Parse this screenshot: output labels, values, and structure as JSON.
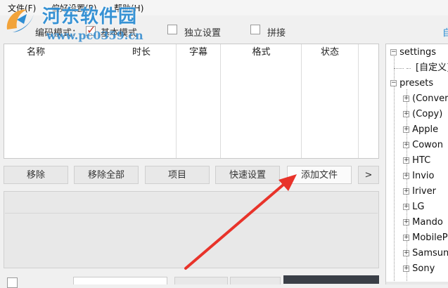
{
  "menu": {
    "file": "文件(F)",
    "prefs": "偏好设置(P)",
    "help": "帮助(H)"
  },
  "toolbar": {
    "mode_label": "编码模式：",
    "basic_mode": "基本模式",
    "independent": "独立设置",
    "splice": "拼接",
    "right_fragment": "自"
  },
  "table": {
    "columns": [
      "名称",
      "时长",
      "字幕",
      "格式",
      "状态"
    ]
  },
  "actions": {
    "remove": "移除",
    "remove_all": "移除全部",
    "item": "项目",
    "quick_settings": "快速设置",
    "add_file": "添加文件",
    "more": ">"
  },
  "watermark": {
    "title": "河东软件园",
    "url": "www.pc0359.cn"
  },
  "tree": {
    "settings": "settings",
    "custom": "[自定义]",
    "presets": "presets",
    "items": [
      "(Conver",
      "(Copy)",
      "Apple",
      "Cowon",
      "HTC",
      "Invio",
      "Iriver",
      "LG",
      "Mando",
      "MobileP",
      "Samsun",
      "Sony"
    ]
  },
  "colors": {
    "accent": "#2d8dd3",
    "arrow": "#e8332a",
    "check": "#c0392b"
  }
}
